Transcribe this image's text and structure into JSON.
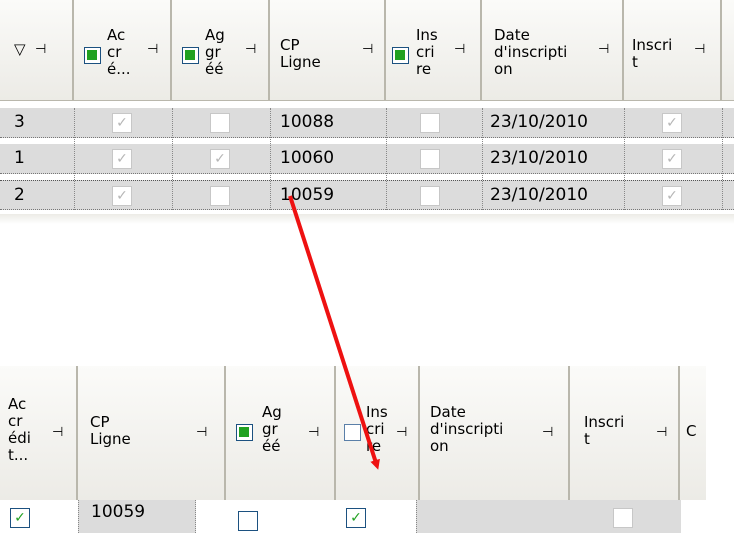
{
  "top_grid": {
    "columns": [
      {
        "label": "Ac\ncr\né..."
      },
      {
        "label": "Ag\ngr\néé"
      },
      {
        "label": "CP\nLigne"
      },
      {
        "label": "Ins\ncri\nre"
      },
      {
        "label": "Date\nd'inscripti\non"
      },
      {
        "label": "Inscri\nt"
      }
    ],
    "rows": [
      {
        "id": "3",
        "cp": "10088",
        "date": "23/10/2010"
      },
      {
        "id": "1",
        "cp": "10060",
        "date": "23/10/2010"
      },
      {
        "id": "2",
        "cp": "10059",
        "date": "23/10/2010"
      }
    ]
  },
  "bottom_grid": {
    "columns": [
      {
        "label": "Ac\ncr\nédi\nt..."
      },
      {
        "label": "CP\nLigne"
      },
      {
        "label": "Ag\ngr\néé"
      },
      {
        "label": "Ins\ncri\nre"
      },
      {
        "label": "Date\nd'inscripti\non"
      },
      {
        "label": "Inscri\nt"
      },
      {
        "label": "C"
      }
    ],
    "row": {
      "cp": "10059"
    }
  },
  "icons": {
    "pin": "⊣",
    "filter": "▽",
    "check": "✓"
  },
  "colors": {
    "check_green": "#21a121",
    "check_grey": "#b6b6b6",
    "arrow_red": "#ee1111"
  }
}
